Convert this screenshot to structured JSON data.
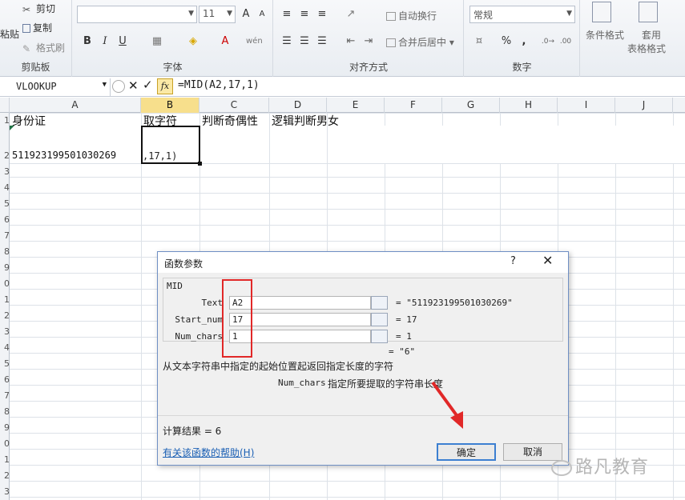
{
  "ribbon": {
    "clipboard": {
      "paste": "粘贴",
      "cut": "剪切",
      "copy": "复制",
      "format_painter": "格式刷",
      "label": "剪贴板"
    },
    "font": {
      "name": "",
      "size": "11",
      "bold": "B",
      "italic": "I",
      "underline": "U",
      "label": "字体"
    },
    "alignment": {
      "wrap_text": "自动换行",
      "merge": "合并后居中",
      "label": "对齐方式"
    },
    "number": {
      "format": "常规",
      "percent": "%",
      "comma": ",",
      "label": "数字"
    },
    "styles": {
      "conditional": "条件格式",
      "table_line1": "套用",
      "table_line2": "表格格式"
    }
  },
  "formula_bar": {
    "name_box": "VLOOKUP",
    "fx": "fx",
    "formula": "=MID(A2,17,1)"
  },
  "columns": [
    "A",
    "B",
    "C",
    "D",
    "E",
    "F",
    "G",
    "H",
    "I",
    "J"
  ],
  "rows": [
    "1",
    "2",
    "3",
    "4",
    "5",
    "6",
    "7",
    "8",
    "9",
    "0",
    "1",
    "2",
    "3",
    "4",
    "5",
    "6",
    "7",
    "8",
    "9",
    "0",
    "1",
    "2",
    "3",
    "4"
  ],
  "cells": {
    "A1": "身份证",
    "B1": "取字符",
    "C1": "判断奇偶性",
    "D1": "逻辑判断男女",
    "A2": "511923199501030269",
    "B2": ",17,1)"
  },
  "dialog": {
    "title": "函数参数",
    "help_q": "?",
    "function_name": "MID",
    "args": [
      {
        "label": "Text",
        "value": "A2",
        "result": "= \"511923199501030269\""
      },
      {
        "label": "Start_num",
        "value": "17",
        "result": "= 17"
      },
      {
        "label": "Num_chars",
        "value": "1",
        "result": "= 1"
      }
    ],
    "overall": "= \"6\"",
    "description": "从文本字符串中指定的起始位置起返回指定长度的字符",
    "arg_help_name": "Num_chars",
    "arg_help_text": "指定所要提取的字符串长度",
    "calc_result": "计算结果 = 6",
    "help_link": "有关该函数的帮助(H)",
    "ok": "确定",
    "cancel": "取消"
  },
  "watermark": "路凡教育",
  "colors": {
    "accent": "#e12828",
    "selection": "#217346"
  }
}
